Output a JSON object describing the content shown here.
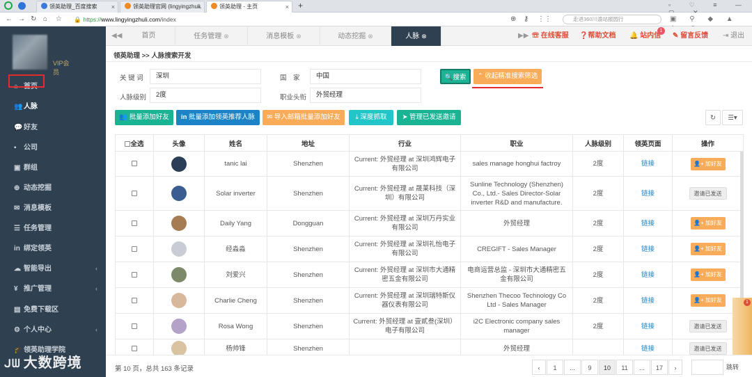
{
  "browser": {
    "tabs": [
      {
        "label": "领英助理_百度搜索",
        "close": "×"
      },
      {
        "label": "领英助理官网 (lingyingzhuli.",
        "close": "×"
      },
      {
        "label": "领英助理 - 主页",
        "close": "×"
      }
    ],
    "new_tab": "+",
    "url_scheme": "https://",
    "url_host": "www.lingyingzhuli.com",
    "url_path": "/index",
    "search_placeholder": "走进360川渝站报园行"
  },
  "sidebar": {
    "vip_label": "VIP会员",
    "items": [
      {
        "label": "首页",
        "icon": "home-icon",
        "glyph": "⌂"
      },
      {
        "label": "人脉",
        "icon": "users-icon",
        "glyph": "👥"
      },
      {
        "label": "好友",
        "icon": "chat-icon",
        "glyph": "💬"
      },
      {
        "label": "公司",
        "icon": "briefcase-icon",
        "glyph": "▪"
      },
      {
        "label": "群组",
        "icon": "group-icon",
        "glyph": "▣"
      },
      {
        "label": "动态挖掘",
        "icon": "crosshair-icon",
        "glyph": "⊕"
      },
      {
        "label": "消息模板",
        "icon": "envelope-icon",
        "glyph": "✉"
      },
      {
        "label": "任务管理",
        "icon": "list-icon",
        "glyph": "☰"
      },
      {
        "label": "绑定领英",
        "icon": "linkedin-icon",
        "glyph": "in"
      },
      {
        "label": "智能导出",
        "icon": "cloud-icon",
        "glyph": "☁"
      },
      {
        "label": "推广管理",
        "icon": "yen-icon",
        "glyph": "¥"
      },
      {
        "label": "免费下载区",
        "icon": "file-icon",
        "glyph": "▤"
      },
      {
        "label": "个人中心",
        "icon": "gear-icon",
        "glyph": "⚙"
      },
      {
        "label": "领英助理学院",
        "icon": "graduation-icon",
        "glyph": "🎓"
      }
    ],
    "watermark": "大数跨境"
  },
  "topnav": {
    "tabs": [
      {
        "label": "首页"
      },
      {
        "label": "任务管理"
      },
      {
        "label": "消息模板"
      },
      {
        "label": "动态挖掘"
      },
      {
        "label": "人脉"
      }
    ],
    "online_service": "在线客服",
    "help_docs": "帮助文档",
    "inbox": "站内信",
    "inbox_count": "1",
    "feedback": "留言反馈",
    "logout": "退出"
  },
  "breadcrumb": "领英助理 >> 人脉搜索开发",
  "form": {
    "keyword_label": "关 键 词",
    "keyword_value": "深圳",
    "country_label": "国　家",
    "country_value": "中国",
    "level_label": "人脉级别",
    "level_value": "2度",
    "title_label": "职业头衔",
    "title_value": "外贸经理",
    "search_button": "搜索",
    "collapse_button": "收起精准搜索筛选"
  },
  "actions": {
    "batch_add": "批量添加好友",
    "batch_recommend": "批量添加领英推荐人脉",
    "import_email": "导入邮箱批量添加好友",
    "deep_fetch": "深度抓取",
    "manage_invites": "管理已发送邀请"
  },
  "table": {
    "headers": [
      "全选",
      "头像",
      "姓名",
      "地址",
      "行业",
      "职业",
      "人脉级别",
      "领英页面",
      "操作"
    ],
    "link_text": "链接",
    "add_label": "加好友",
    "sent_label": "邀请已发送",
    "rows": [
      {
        "name": "tanic lai",
        "address": "Shenzhen",
        "industry": "Current: 外贸经理 at 深圳鸿辉电子有限公司",
        "job": "sales manage honghui factroy",
        "level": "2度",
        "action": "add",
        "avatar": "#2c3e57"
      },
      {
        "name": "Solar inverter",
        "address": "Shenzhen",
        "industry": "Current: 外贸经理 at 晟莱科技（深圳）有限公司",
        "job": "Sunline Technology (Shenzhen) Co., Ltd.- Sales Director-Solar inverter R&D and manufacture.",
        "level": "2度",
        "action": "sent",
        "avatar": "#3b5d8f"
      },
      {
        "name": "Daily Yang",
        "address": "Dongguan",
        "industry": "Current: 外贸经理 at 深圳万丹实业有限公司",
        "job": "外贸经理",
        "level": "2度",
        "action": "add",
        "avatar": "#a67c52"
      },
      {
        "name": "经淼淼",
        "address": "Shenzhen",
        "industry": "Current: 外贸经理 at 深圳礼怡电子有限公司",
        "job": "CREGIFT - Sales Manager",
        "level": "2度",
        "action": "add",
        "avatar": "#c9ccd4"
      },
      {
        "name": "刘爱兴",
        "address": "Shenzhen",
        "industry": "Current: 外贸经理 at 深圳市大通精密五金有限公司",
        "job": "电商运营总监 - 深圳市大通精密五金有限公司",
        "level": "2度",
        "action": "add",
        "avatar": "#7d8a6a"
      },
      {
        "name": "Charlie Cheng",
        "address": "Shenzhen",
        "industry": "Current: 外贸经理 at 深圳瑞特斯仪器仪表有限公司",
        "job": "Shenzhen Thecoo Technology Co Ltd - Sales Manager",
        "level": "2度",
        "action": "add",
        "avatar": "#d8b89a"
      },
      {
        "name": "Rosa Wong",
        "address": "Shenzhen",
        "industry": "Current: 外贸经理 at 壹貳叁(深圳）电子有限公司",
        "job": "i2C Electronic company sales manager",
        "level": "2度",
        "action": "sent",
        "avatar": "#b5a2c8"
      },
      {
        "name": "杨帅锋",
        "address": "Shenzhen",
        "industry": "",
        "job": "外贸经理",
        "level": "",
        "action": "sent",
        "avatar": "#d9c3a0"
      }
    ]
  },
  "pagination": {
    "info": "第 10 页，总共 163 条记录",
    "prev": "‹",
    "pages": [
      "1",
      "...",
      "9",
      "10",
      "11",
      "...",
      "17"
    ],
    "next": "›",
    "jump": "跳转"
  }
}
